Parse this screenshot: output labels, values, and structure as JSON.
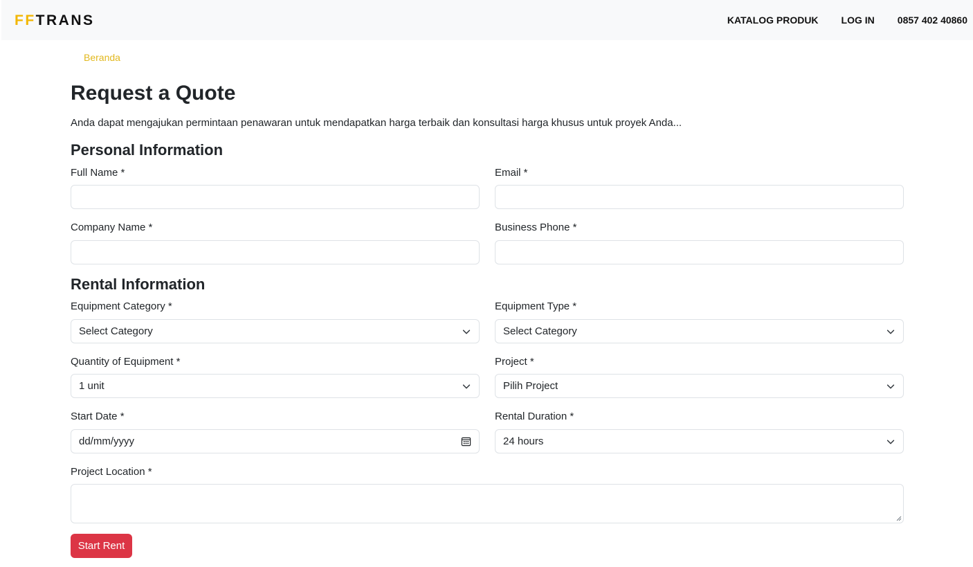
{
  "nav": {
    "brand_accent": "FF",
    "brand_rest": "TRANS",
    "links": [
      "KATALOG PRODUK",
      "LOG IN",
      "0857 402 40860"
    ]
  },
  "breadcrumb": "Beranda",
  "page": {
    "title": "Request a Quote",
    "intro": "Anda dapat mengajukan permintaan penawaran untuk mendapatkan harga terbaik dan konsultasi harga khusus untuk proyek Anda..."
  },
  "personal": {
    "title": "Personal Information",
    "full_name_label": "Full Name *",
    "email_label": "Email *",
    "company_label": "Company Name *",
    "phone_label": "Business Phone *"
  },
  "rental": {
    "title": "Rental Information",
    "category_label": "Equipment Category *",
    "category_value": "Select Category",
    "type_label": "Equipment Type *",
    "type_value": "Select Category",
    "quantity_label": "Quantity of Equipment *",
    "quantity_value": "1 unit",
    "project_label": "Project *",
    "project_value": "Pilih Project",
    "start_date_label": "Start Date *",
    "start_date_placeholder": "dd/mm/yyyy",
    "duration_label": "Rental Duration *",
    "duration_value": "24 hours",
    "location_label": "Project Location *"
  },
  "submit_label": "Start Rent",
  "colors": {
    "brand_accent": "#f2b705",
    "breadcrumb": "#e2b81e",
    "button": "#dc3545"
  },
  "icons": {
    "select": "chevron-down-icon",
    "date": "calendar-icon"
  }
}
